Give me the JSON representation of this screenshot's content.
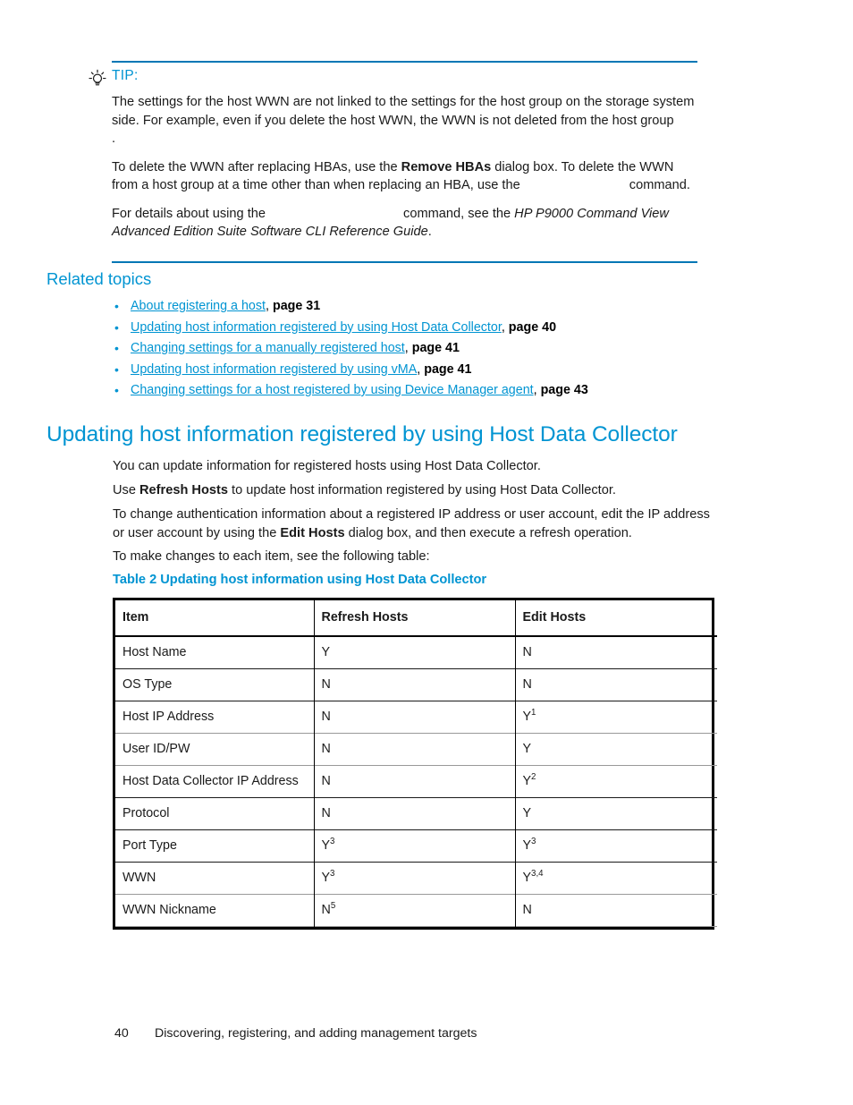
{
  "tip": {
    "icon": "lightbulb-icon",
    "label": "TIP:",
    "paragraph_1_a": "The settings for the host WWN are not linked to the settings for the host group on the storage system side. For example, even if you delete the host WWN, the WWN is not deleted from the host group",
    "paragraph_1_b": ".",
    "paragraph_2_a": "To delete the WWN after replacing HBAs, use the ",
    "paragraph_2_bold": "Remove HBAs",
    "paragraph_2_b": " dialog box. To delete the WWN from a host group at a time other than when replacing an HBA, use the ",
    "paragraph_2_c": "command.",
    "paragraph_3_a": "For details about using the ",
    "paragraph_3_b": "command, see the ",
    "paragraph_3_italic": "HP P9000 Command View Advanced Edition Suite Software CLI Reference Guide",
    "paragraph_3_c": "."
  },
  "related": {
    "heading": "Related topics",
    "items": [
      {
        "link": "About registering a host",
        "separator": ", ",
        "page": "page 31"
      },
      {
        "link": "Updating host information registered by using Host Data Collector",
        "separator": ", ",
        "page": "page 40"
      },
      {
        "link": "Changing settings for a manually registered host",
        "separator": ", ",
        "page": "page 41"
      },
      {
        "link": "Updating host information registered by using vMA",
        "separator": ", ",
        "page": "page 41"
      },
      {
        "link": "Changing settings for a host registered by using Device Manager agent",
        "separator": ", ",
        "page": "page 43"
      }
    ]
  },
  "section": {
    "heading": "Updating host information registered by using Host Data Collector",
    "para_1": "You can update information for registered hosts using Host Data Collector.",
    "para_2_a": "Use ",
    "para_2_bold": "Refresh Hosts",
    "para_2_b": " to update host information registered by using Host Data Collector.",
    "para_3_a": "To change authentication information about a registered IP address or user account, edit the IP address or user account by using the ",
    "para_3_bold": "Edit Hosts",
    "para_3_b": " dialog box, and then execute a refresh operation.",
    "para_4": "To make changes to each item, see the following table:"
  },
  "table": {
    "caption": "Table 2 Updating host information using Host Data Collector",
    "columns": [
      "Item",
      "Refresh Hosts",
      "Edit Hosts"
    ],
    "rows": [
      {
        "item": "Host Name",
        "refresh": "Y",
        "refresh_sup": "",
        "edit": "N",
        "edit_sup": ""
      },
      {
        "item": "OS Type",
        "refresh": "N",
        "refresh_sup": "",
        "edit": "N",
        "edit_sup": ""
      },
      {
        "item": "Host IP Address",
        "refresh": "N",
        "refresh_sup": "",
        "edit": "Y",
        "edit_sup": "1"
      },
      {
        "item": "User ID/PW",
        "refresh": "N",
        "refresh_sup": "",
        "edit": "Y",
        "edit_sup": ""
      },
      {
        "item": "Host Data Collector IP Address",
        "refresh": "N",
        "refresh_sup": "",
        "edit": "Y",
        "edit_sup": "2"
      },
      {
        "item": "Protocol",
        "refresh": "N",
        "refresh_sup": "",
        "edit": "Y",
        "edit_sup": ""
      },
      {
        "item": "Port Type",
        "refresh": "Y",
        "refresh_sup": "3",
        "edit": "Y",
        "edit_sup": "3"
      },
      {
        "item": "WWN",
        "refresh": "Y",
        "refresh_sup": "3",
        "edit": "Y",
        "edit_sup": "3,4"
      },
      {
        "item": "WWN Nickname",
        "refresh": "N",
        "refresh_sup": "5",
        "edit": "N",
        "edit_sup": ""
      }
    ]
  },
  "footer": {
    "page_number": "40",
    "chapter": "Discovering, registering, and adding management targets"
  },
  "colors": {
    "accent_blue": "#0094d2",
    "rule_blue": "#0077b5",
    "text_black": "#1a1a1a",
    "row_divider_dark": "#1a1a1a",
    "row_divider_light": "#999999"
  }
}
